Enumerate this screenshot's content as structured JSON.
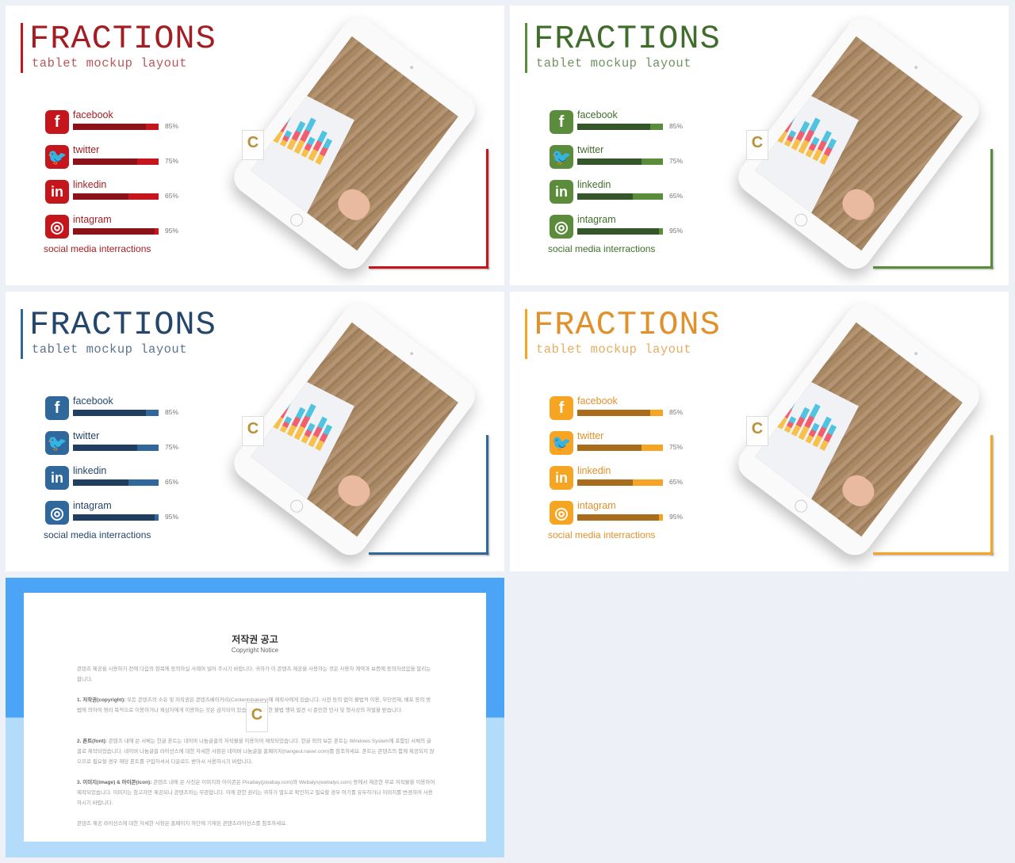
{
  "slides": [
    {
      "title": "FRACTIONS",
      "subtitle": "tablet mockup layout",
      "caption": "social media interractions",
      "colors": {
        "accent": "#c4161c",
        "dark": "#8a1218",
        "title": "#a31e22"
      },
      "items": [
        {
          "label": "facebook",
          "icon": "facebook-icon",
          "percent": "85%",
          "value": 85
        },
        {
          "label": "twitter",
          "icon": "twitter-icon",
          "percent": "75%",
          "value": 75
        },
        {
          "label": "linkedin",
          "icon": "linkedin-icon",
          "percent": "65%",
          "value": 65
        },
        {
          "label": "intagram",
          "icon": "instagram-icon",
          "percent": "95%",
          "value": 95
        }
      ]
    },
    {
      "title": "FRACTIONS",
      "subtitle": "tablet mockup layout",
      "caption": "social media interractions",
      "colors": {
        "accent": "#5b8c3b",
        "dark": "#34562a",
        "title": "#416d2c"
      },
      "items": [
        {
          "label": "facebook",
          "icon": "facebook-icon",
          "percent": "85%",
          "value": 85
        },
        {
          "label": "twitter",
          "icon": "twitter-icon",
          "percent": "75%",
          "value": 75
        },
        {
          "label": "linkedin",
          "icon": "linkedin-icon",
          "percent": "65%",
          "value": 65
        },
        {
          "label": "intagram",
          "icon": "instagram-icon",
          "percent": "95%",
          "value": 95
        }
      ]
    },
    {
      "title": "FRACTIONS",
      "subtitle": "tablet mockup layout",
      "caption": "social media interractions",
      "colors": {
        "accent": "#30689c",
        "dark": "#203f60",
        "title": "#24466b"
      },
      "items": [
        {
          "label": "facebook",
          "icon": "facebook-icon",
          "percent": "85%",
          "value": 85
        },
        {
          "label": "twitter",
          "icon": "twitter-icon",
          "percent": "75%",
          "value": 75
        },
        {
          "label": "linkedin",
          "icon": "linkedin-icon",
          "percent": "65%",
          "value": 65
        },
        {
          "label": "intagram",
          "icon": "instagram-icon",
          "percent": "95%",
          "value": 95
        }
      ]
    },
    {
      "title": "FRACTIONS",
      "subtitle": "tablet mockup layout",
      "caption": "social media interractions",
      "colors": {
        "accent": "#f6a522",
        "dark": "#a86c1c",
        "title": "#e0912b"
      },
      "items": [
        {
          "label": "facebook",
          "icon": "facebook-icon",
          "percent": "85%",
          "value": 85
        },
        {
          "label": "twitter",
          "icon": "twitter-icon",
          "percent": "75%",
          "value": 75
        },
        {
          "label": "linkedin",
          "icon": "linkedin-icon",
          "percent": "65%",
          "value": 65
        },
        {
          "label": "intagram",
          "icon": "instagram-icon",
          "percent": "95%",
          "value": 95
        }
      ]
    }
  ],
  "watermark": "C",
  "copyright": {
    "title": "저작권 공고",
    "subtitle": "Copyright Notice",
    "intro": "콘텐츠 제공을 시용하기 전에 다음의 항목에 동의하실 사례여 빌어 주시기 바랍니다. 귀하가 이 콘텐츠 제공을 사용하는 것은 사용자 계약과 보증에 동의하셨음을 말리는합니다.",
    "p1_head": "1. 저작권(copyright):",
    "p1": "모든 콘텐츠의 소유 및 저작권은 콘텐츠베이커리(Contentsbakery)에 제작사에게 있습니다. 사전 동의 없이 불법적 이용, 무단전재, 배포 등의 방법에 의하여 영리 목적으로 이용하거나 제삼자에게 이용하는 것은 금지되어 있습니다. 이러한 불법 행위 발견 시 준민한 민사 및 형사상의 처벌을 받습니다.",
    "p2_head": "2. 폰트(font):",
    "p2": "콘텐츠 내에 쓴 서체는 한글 폰트는 네이버 나눔글꼴의 저작물을 이용하여 제작되었습니다. 한글 외의 보든 폰트는 Windows System에 포함된 서체의 글꼴로 제작되었습니다. 네이버 나눔글꼴 라이선스에 대한 자세한 사항은 네이버 나눔글꼴 홈페이지(hangeul.naver.com)를 참조하세요. 폰트는 콘텐츠의 함께 제공되지 않으므로 필요할 경우 해당 폰트를 구입하셔서 다운로드 받아서 사용하시기 바랍니다.",
    "p3_head": "3. 이미지(image) & 아이콘(icon):",
    "p3": "콘텐츠 내에 쓴 사진은 이미지와 아이콘은 Pixabay(pixabay.com)와 Webalys(webalys.com) 등에서 제공한 무료 저작물을 이용하여 제작되었습니다. 이미지는 참고자만 제공되나 콘텐츠와는 무관합니다. 이에 관한 권리는 귀하가 별도로 확인하고 필요할 경우 여기를 유두하거나 이미지를 변경하여 사용하시기 바랍니다.",
    "outro": "콘텐츠 제공 라이선스에 대한 자세한 사항은 홈페이지 하단에 기재된 콘텐츠라이선스를 참조하세요."
  }
}
